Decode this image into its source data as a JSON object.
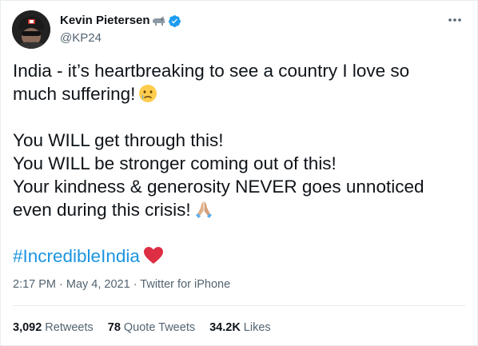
{
  "author": {
    "display_name": "Kevin Pietersen",
    "handle": "@KP24",
    "name_emoji": "rhino-icon",
    "verified_icon": "verified-badge-icon"
  },
  "tweet": {
    "line1": "India - it’s heartbreaking to see a country I love so",
    "line2": "much suffering!",
    "line2_emoji": "crying-face-icon",
    "line3": "You WILL get through this!",
    "line4": "You WILL be stronger coming out of this!",
    "line5": "Your kindness & generosity NEVER goes unnoticed",
    "line6": "even during this crisis!",
    "line6_emoji": "folded-hands-icon",
    "hashtag": "#IncredibleIndia",
    "hashtag_emoji": "red-heart-icon"
  },
  "meta": {
    "text": "2:17 PM · May 4, 2021 · Twitter for iPhone"
  },
  "stats": {
    "retweets_count": "3,092",
    "retweets_label": "Retweets",
    "quote_count": "78",
    "quote_label": "Quote Tweets",
    "likes_count": "34.2K",
    "likes_label": "Likes"
  },
  "colors": {
    "hashtag": "#1b95e0",
    "verified": "#1d9bf0",
    "muted_text": "#536471",
    "divider": "#e6ecf0"
  }
}
